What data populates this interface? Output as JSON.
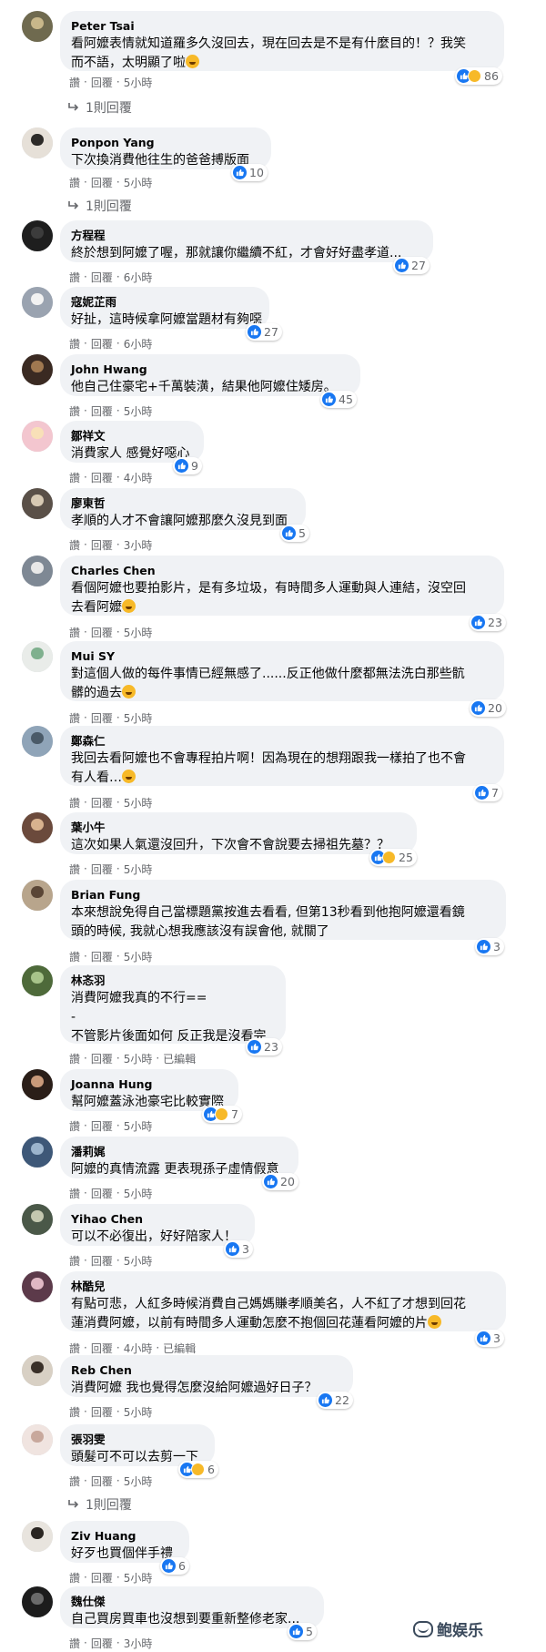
{
  "labels": {
    "like": "讚",
    "reply": "回覆",
    "dot": "·",
    "edited": "已編輯"
  },
  "watermark": "鲍娱乐",
  "colors": {
    "reaction_like": "#1877f2",
    "reaction_haha": "#f7b928",
    "muted": "#65676b",
    "bubble": "#f0f2f5"
  },
  "comments": [
    {
      "name": "Peter Tsai",
      "lines": [
        "看阿嬤表情就知道羅多久沒回去，現在回去是不是有什麼目的！？我笑",
        "而不語，太明顯了啦"
      ],
      "reactions": "86",
      "time": "5小時",
      "replies": "1則回覆"
    },
    {
      "name": "Ponpon Yang",
      "lines": [
        "下次換消費他往生的爸爸搏版面"
      ],
      "reactions": "10",
      "time": "5小時",
      "replies": "1則回覆"
    },
    {
      "name": "方程程",
      "lines": [
        "終於想到阿嬤了喔，那就讓你繼續不紅，才會好好盡孝道..."
      ],
      "reactions": "27",
      "time": "6小時"
    },
    {
      "name": "寇妮芷雨",
      "lines": [
        "好扯，這時候拿阿嬤當題材有夠噁"
      ],
      "reactions": "27",
      "time": "6小時"
    },
    {
      "name": "John Hwang",
      "lines": [
        "他自己住豪宅+千萬裝潢，結果他阿嬤住矮房。"
      ],
      "reactions": "45",
      "time": "5小時"
    },
    {
      "name": "鄒祥文",
      "lines": [
        "消費家人 感覺好噁心"
      ],
      "reactions": "9",
      "time": "4小時"
    },
    {
      "name": "廖東哲",
      "lines": [
        "孝順的人才不會讓阿嬤那麼久沒見到面"
      ],
      "reactions": "5",
      "time": "3小時"
    },
    {
      "name": "Charles Chen",
      "lines": [
        "看個阿嬤也要拍影片，是有多垃圾，有時間多人運動與人連結，沒空回",
        "去看阿嬤"
      ],
      "reactions": "23",
      "time": "5小時"
    },
    {
      "name": "Mui SY",
      "lines": [
        "對這個人做的每件事情已經無感了......反正他做什麼都無法洗白那些骯",
        "髒的過去"
      ],
      "reactions": "20",
      "time": "5小時"
    },
    {
      "name": "鄭森仁",
      "lines": [
        "我回去看阿嬤也不會專程拍片啊！因為現在的想翔跟我一樣拍了也不會",
        "有人看…"
      ],
      "reactions": "7",
      "time": "5小時"
    },
    {
      "name": "葉小牛",
      "lines": [
        "這次如果人氣還沒回升，下次會不會說要去掃祖先墓？？"
      ],
      "reactions": "25",
      "time": "5小時"
    },
    {
      "name": "Brian Fung",
      "lines": [
        "本來想說免得自己當標題黨按進去看看, 但第13秒看到他抱阿嬤還看鏡",
        "頭的時候, 我就心想我應該沒有誤會他, 就關了"
      ],
      "reactions": "3",
      "time": "5小時"
    },
    {
      "name": "林忞羽",
      "lines": [
        "消費阿嬤我真的不行==",
        "-",
        "不管影片後面如何 反正我是沒看完"
      ],
      "reactions": "23",
      "time": "5小時"
    },
    {
      "name": "Joanna Hung",
      "lines": [
        "幫阿嬤蓋泳池豪宅比較實際"
      ],
      "reactions": "7",
      "time": "5小時"
    },
    {
      "name": "潘莉娓",
      "lines": [
        "阿嬤的真情流露 更表現孫子虛情假意"
      ],
      "reactions": "20",
      "time": "5小時"
    },
    {
      "name": "Yihao Chen",
      "lines": [
        "可以不必復出，好好陪家人！"
      ],
      "reactions": "3",
      "time": "5小時"
    },
    {
      "name": "林酷兒",
      "lines": [
        "有點可悲，人紅多時候消費自己媽媽賺孝順美名，人不紅了才想到回花",
        "蓮消費阿嬤，以前有時間多人運動怎麼不抱個回花蓮看阿嬤的片"
      ],
      "reactions": "3",
      "time": "4小時"
    },
    {
      "name": "Reb Chen",
      "lines": [
        "消費阿嬤 我也覺得怎麼沒給阿嬤過好日子？"
      ],
      "reactions": "22",
      "time": "5小時"
    },
    {
      "name": "張羽雯",
      "lines": [
        "頭髮可不可以去剪一下"
      ],
      "reactions": "6",
      "time": "5小時",
      "replies": "1則回覆"
    },
    {
      "name": "Ziv Huang",
      "lines": [
        "好歹也買個伴手禮"
      ],
      "reactions": "6",
      "time": "5小時"
    },
    {
      "name": "魏仕傑",
      "lines": [
        "自己買房買車也沒想到要重新整修老家..."
      ],
      "reactions": "5",
      "time": "3小時"
    }
  ]
}
